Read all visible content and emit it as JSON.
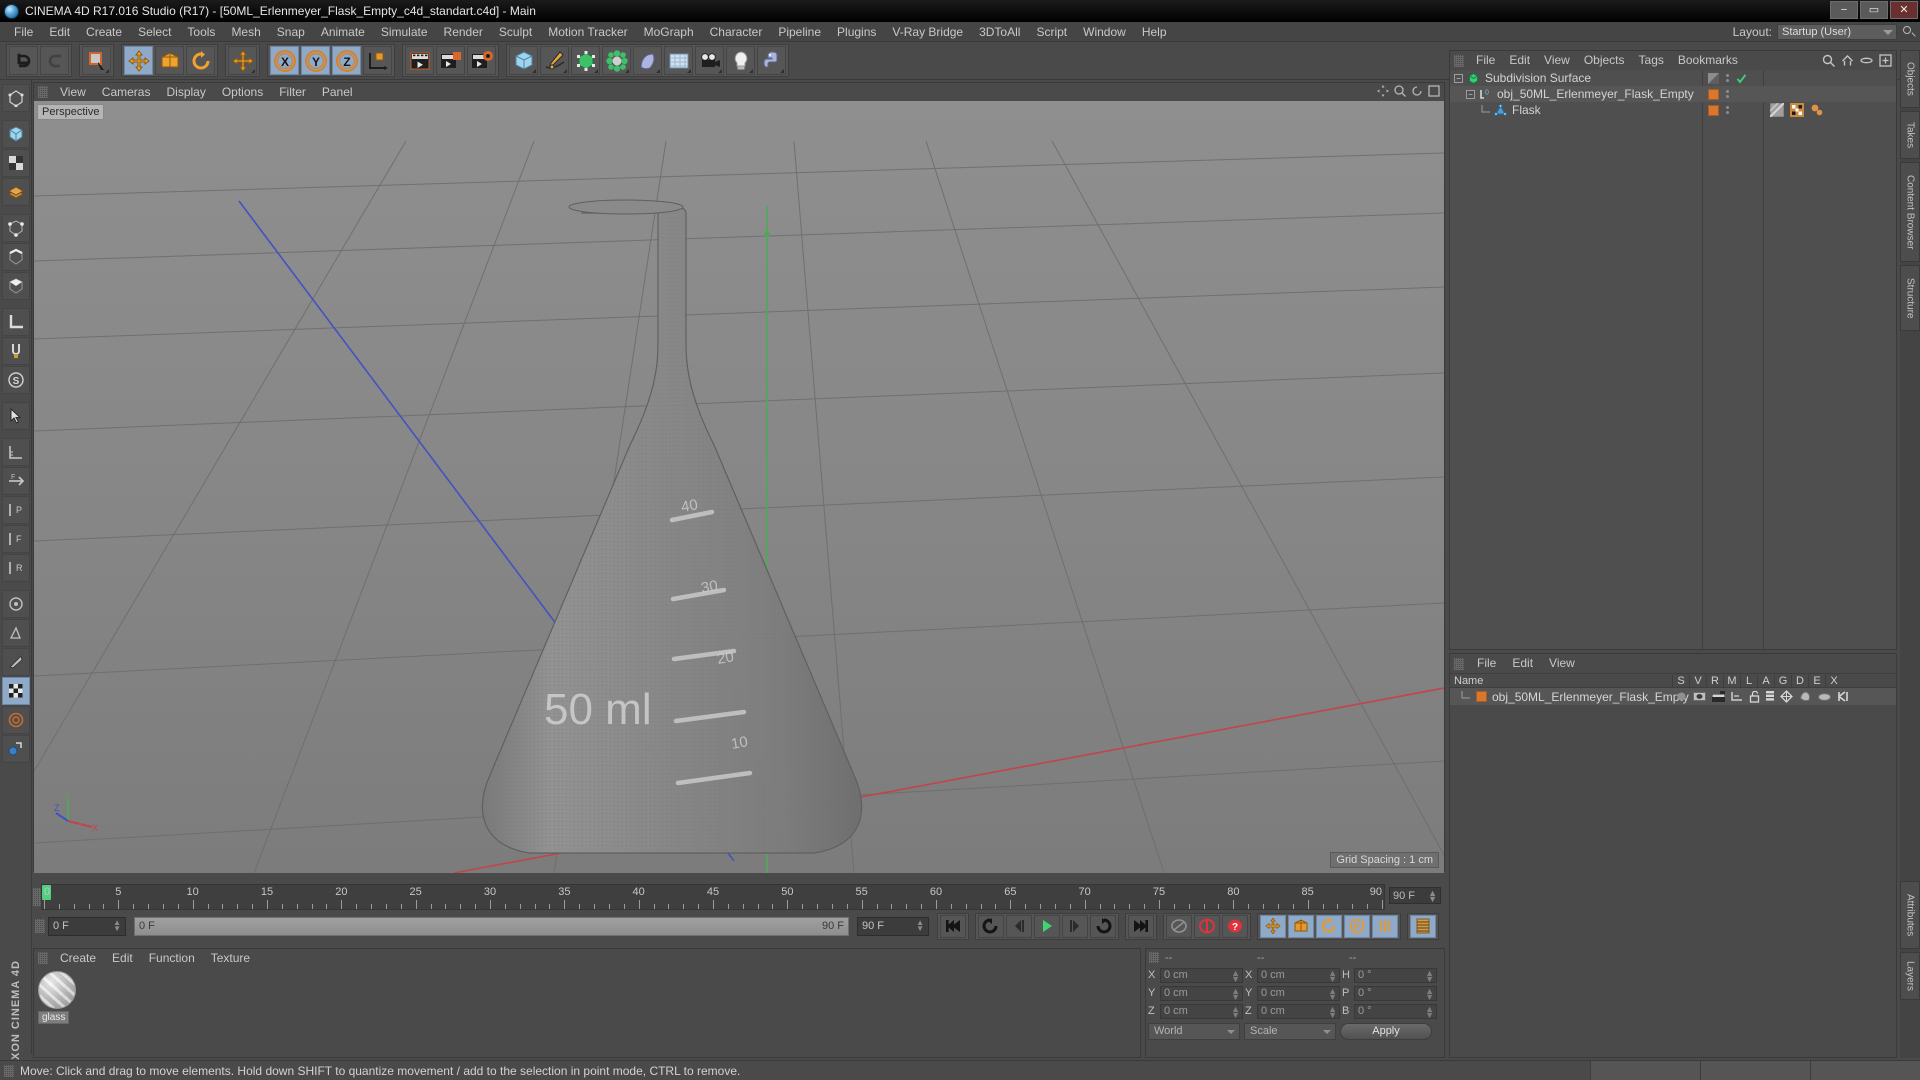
{
  "window": {
    "title": "CINEMA 4D R17.016 Studio (R17) - [50ML_Erlenmeyer_Flask_Empty_c4d_standart.c4d] - Main",
    "minimize": "−",
    "maximize": "▭",
    "close": "✕"
  },
  "menubar": {
    "items": [
      "File",
      "Edit",
      "Create",
      "Select",
      "Tools",
      "Mesh",
      "Snap",
      "Animate",
      "Simulate",
      "Render",
      "Sculpt",
      "Motion Tracker",
      "MoGraph",
      "Character",
      "Pipeline",
      "Plugins",
      "V-Ray Bridge",
      "3DToAll",
      "Script",
      "Window",
      "Help"
    ],
    "layout_label": "Layout:",
    "layout_value": "Startup (User)"
  },
  "viewport": {
    "menu": [
      "View",
      "Cameras",
      "Display",
      "Options",
      "Filter",
      "Panel"
    ],
    "camera_label": "Perspective",
    "grid_spacing": "Grid Spacing : 1 cm",
    "flask_text": "50 ml",
    "gradation": [
      "40",
      "30",
      "20"
    ],
    "axis": {
      "x": "X",
      "y": "Y",
      "z": "Z"
    }
  },
  "object_manager": {
    "menu": [
      "File",
      "Edit",
      "View",
      "Objects",
      "Tags",
      "Bookmarks"
    ],
    "rows": [
      {
        "label": "Subdivision Surface",
        "depth": 0,
        "expander": "−",
        "icon": "subdivision-surface-icon"
      },
      {
        "label": "obj_50ML_Erlenmeyer_Flask_Empty",
        "depth": 1,
        "expander": "−",
        "icon": "null-object-icon"
      },
      {
        "label": "Flask",
        "depth": 2,
        "expander": "",
        "icon": "polygon-object-icon"
      }
    ]
  },
  "layer_manager": {
    "menu": [
      "File",
      "Edit",
      "View"
    ],
    "columns": [
      "Name",
      "S",
      "V",
      "R",
      "M",
      "L",
      "A",
      "G",
      "D",
      "E",
      "X"
    ],
    "rows": [
      {
        "name": "obj_50ML_Erlenmeyer_Flask_Empty"
      }
    ]
  },
  "timeline": {
    "ticks": [
      "0",
      "5",
      "10",
      "15",
      "20",
      "25",
      "30",
      "35",
      "40",
      "45",
      "50",
      "55",
      "60",
      "65",
      "70",
      "75",
      "80",
      "85",
      "90"
    ],
    "min_frame": 0,
    "max_frame": 90,
    "current_frame_field": "0 F",
    "range_start": "0 F",
    "range_end": "90 F",
    "end_frame_field": "90 F",
    "preview_field": "0 F"
  },
  "material_manager": {
    "menu": [
      "Create",
      "Edit",
      "Function",
      "Texture"
    ],
    "materials": [
      {
        "name": "glass"
      }
    ]
  },
  "coordinates": {
    "headers": [
      "--",
      "--",
      "--"
    ],
    "position": {
      "label_x": "X",
      "label_y": "Y",
      "label_z": "Z",
      "x": "0 cm",
      "y": "0 cm",
      "z": "0 cm"
    },
    "size": {
      "label_x": "X",
      "label_y": "Y",
      "label_z": "Z",
      "x": "0 cm",
      "y": "0 cm",
      "z": "0 cm"
    },
    "rotation": {
      "label_h": "H",
      "label_p": "P",
      "label_b": "B",
      "h": "0 °",
      "p": "0 °",
      "b": "0 °"
    },
    "system": "World",
    "mode": "Scale",
    "apply": "Apply"
  },
  "right_dock_tabs": [
    "Objects",
    "Takes",
    "Content Browser",
    "Structure",
    "Attributes",
    "Layers"
  ],
  "statusbar": {
    "message": "Move: Click and drag to move elements. Hold down SHIFT to quantize movement / add to the selection in point mode, CTRL to remove."
  },
  "colors": {
    "accent_orange": "#d9772e",
    "active_blue": "#8fa9c9",
    "panel_bg": "#4a4a4a",
    "viewport_bg": "#878787",
    "green_playhead": "#4fd07f",
    "red_axis": "#c3444a",
    "blue_axis": "#4452c0",
    "green_axis": "#4fa85a"
  }
}
